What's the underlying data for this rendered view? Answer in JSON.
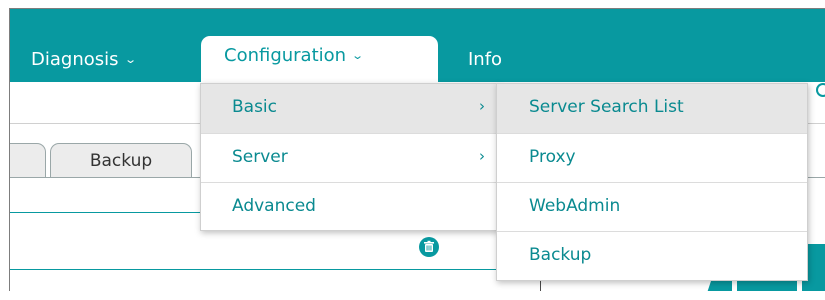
{
  "nav": {
    "items": [
      {
        "label": "Diagnosis"
      },
      {
        "label": "Configuration"
      },
      {
        "label": "Info"
      }
    ],
    "chevron": "⌄"
  },
  "tabs": {
    "backup_label": "Backup"
  },
  "config_menu": {
    "items": [
      {
        "label": "Basic",
        "arrow": "›"
      },
      {
        "label": "Server",
        "arrow": "›"
      },
      {
        "label": "Advanced"
      }
    ]
  },
  "basic_submenu": {
    "items": [
      {
        "label": "Server Search List"
      },
      {
        "label": "Proxy"
      },
      {
        "label": "WebAdmin"
      },
      {
        "label": "Backup"
      }
    ]
  },
  "colors": {
    "brand": "#0899a0",
    "menu_text": "#0a8a90",
    "hover_bg": "#e6e6e6"
  },
  "icons": [
    "help-icon",
    "trash-icon"
  ]
}
